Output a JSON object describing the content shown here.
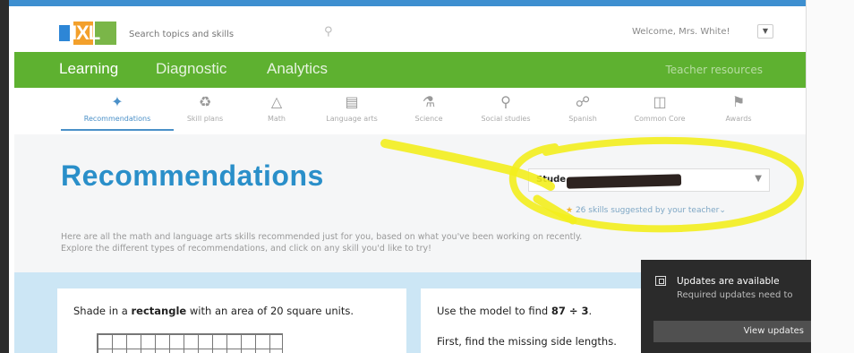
{
  "header": {
    "logo_text": "IXL",
    "search_placeholder": "Search topics and skills",
    "welcome": "Welcome, Mrs. White!"
  },
  "nav": {
    "items": [
      "Learning",
      "Diagnostic",
      "Analytics"
    ],
    "right": "Teacher resources"
  },
  "subtabs": [
    {
      "label": "Recommendations",
      "icon": "recommendations-icon"
    },
    {
      "label": "Skill plans",
      "icon": "skill-plans-icon"
    },
    {
      "label": "Math",
      "icon": "math-icon"
    },
    {
      "label": "Language arts",
      "icon": "language-arts-icon"
    },
    {
      "label": "Science",
      "icon": "science-icon"
    },
    {
      "label": "Social studies",
      "icon": "social-studies-icon"
    },
    {
      "label": "Spanish",
      "icon": "spanish-icon"
    },
    {
      "label": "Common Core",
      "icon": "common-core-icon"
    },
    {
      "label": "Awards",
      "icon": "awards-icon"
    }
  ],
  "main": {
    "title": "Recommendations",
    "student_label": "Stude",
    "suggested": "26 skills suggested by your teacher",
    "intro_line1": "Here are all the math and language arts skills recommended just for you, based on what you've been working on recently.",
    "intro_line2": "Explore the different types of recommendations, and click on any skill you'd like to try!"
  },
  "cards": {
    "card1_pre": "Shade in a ",
    "card1_bold": "rectangle",
    "card1_post": " with an area of 20 square units.",
    "card2_pre": "Use the model to find ",
    "card2_bold": "87 ÷ 3",
    "card2_post": ".",
    "card2_line2": "First, find the missing side lengths."
  },
  "toast": {
    "title": "Updates are available",
    "subtitle": "Required updates need to",
    "button": "View updates"
  },
  "colors": {
    "nav_green": "#5eb130",
    "title_blue": "#2a8fc9",
    "highlight_yellow": "#f3ee1d"
  }
}
